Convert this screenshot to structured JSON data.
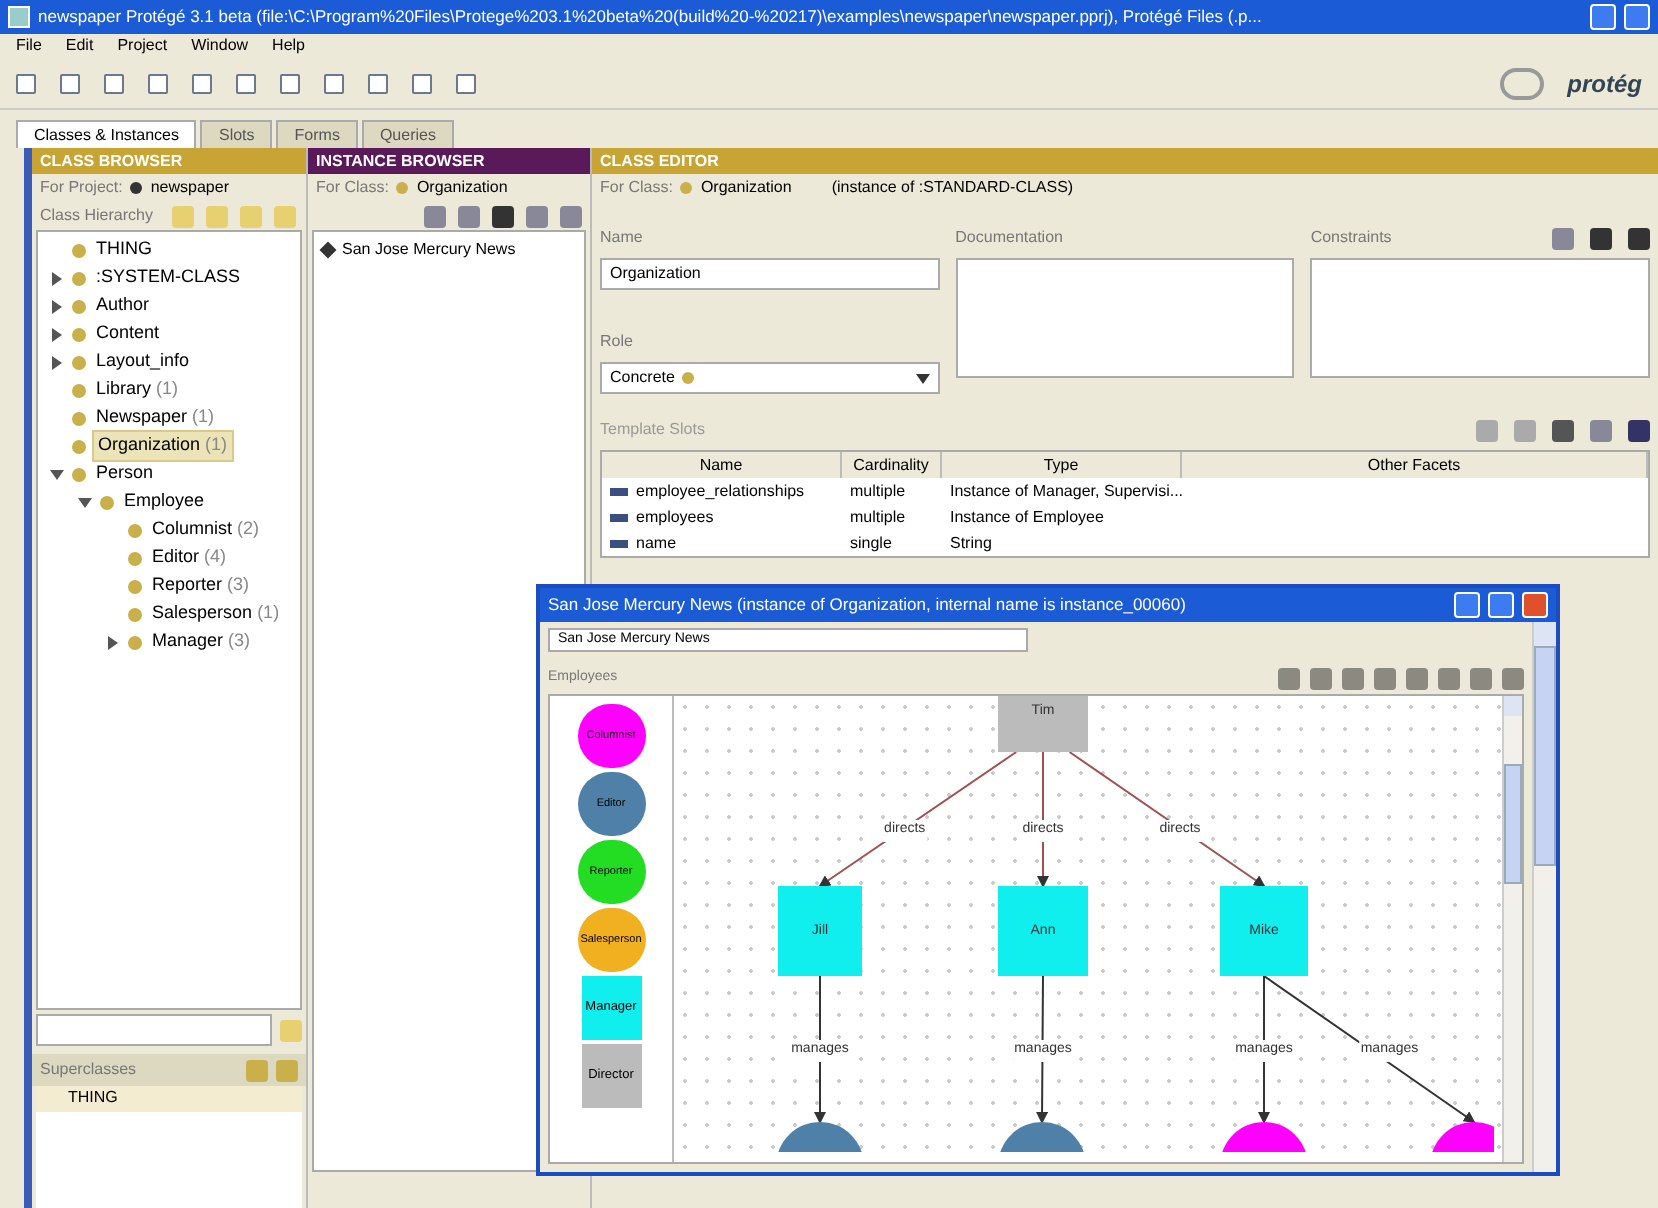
{
  "window": {
    "title": "newspaper  Protégé 3.1 beta   (file:\\C:\\Program%20Files\\Protege%203.1%20beta%20(build%20-%20217)\\examples\\newspaper\\newspaper.pprj), Protégé Files (.p..."
  },
  "menu": [
    "File",
    "Edit",
    "Project",
    "Window",
    "Help"
  ],
  "logo": "protég",
  "tabs": [
    {
      "label": "Classes & Instances",
      "selected": true
    },
    {
      "label": "Slots",
      "selected": false
    },
    {
      "label": "Forms",
      "selected": false
    },
    {
      "label": "Queries",
      "selected": false
    }
  ],
  "class_browser": {
    "header": "CLASS BROWSER",
    "project_label": "For Project:",
    "project": "newspaper",
    "hierarchy_label": "Class Hierarchy",
    "tree": [
      {
        "label": "THING",
        "selected": false
      },
      {
        "label": ":SYSTEM-CLASS",
        "expanded": false,
        "selected": false
      },
      {
        "label": "Author",
        "expanded": false,
        "selected": false
      },
      {
        "label": "Content",
        "expanded": false,
        "selected": false
      },
      {
        "label": "Layout_info",
        "expanded": false,
        "selected": false
      },
      {
        "label": "Library",
        "count": "(1)",
        "selected": false
      },
      {
        "label": "Newspaper",
        "count": "(1)",
        "selected": false
      },
      {
        "label": "Organization",
        "count": "(1)",
        "selected": true
      },
      {
        "label": "Person",
        "expanded": true,
        "selected": false,
        "children": [
          {
            "label": "Employee",
            "expanded": true,
            "selected": false,
            "children": [
              {
                "label": "Columnist",
                "count": "(2)",
                "selected": false
              },
              {
                "label": "Editor",
                "count": "(4)",
                "selected": false
              },
              {
                "label": "Reporter",
                "count": "(3)",
                "selected": false
              },
              {
                "label": "Salesperson",
                "count": "(1)",
                "selected": false
              },
              {
                "label": "Manager",
                "count": "(3)",
                "expanded": false,
                "selected": false
              }
            ]
          }
        ]
      }
    ],
    "superclasses_label": "Superclasses",
    "superclasses": [
      "THING"
    ]
  },
  "instance_browser": {
    "header": "INSTANCE BROWSER",
    "class_label": "For Class:",
    "class": "Organization",
    "instances": [
      {
        "label": "San Jose Mercury News",
        "selected": false
      }
    ]
  },
  "class_editor": {
    "header": "CLASS EDITOR",
    "class_label": "For Class:",
    "class": "Organization",
    "instance_of": "(instance of :STANDARD-CLASS)",
    "name_label": "Name",
    "name": "Organization",
    "documentation_label": "Documentation",
    "constraints_label": "Constraints",
    "role_label": "Role",
    "role": "Concrete",
    "template_slots_label": "Template Slots",
    "columns": [
      "Name",
      "Cardinality",
      "Type",
      "Other Facets"
    ],
    "rows": [
      [
        "employee_relationships",
        "multiple",
        "Instance of Manager, Supervisi...",
        ""
      ],
      [
        "employees",
        "multiple",
        "Instance of Employee",
        ""
      ],
      [
        "name",
        "single",
        "String",
        ""
      ]
    ]
  },
  "instance_window": {
    "title": "San Jose Mercury News   (instance of Organization, internal name is instance_00060)",
    "name_value": "San Jose Mercury News",
    "employees_label": "Employees",
    "legend": [
      {
        "label": "Columnist",
        "kind": "circle",
        "color": "#ff00ff"
      },
      {
        "label": "Editor",
        "kind": "circle",
        "color": "#4f81a8"
      },
      {
        "label": "Reporter",
        "kind": "circle",
        "color": "#22dd22"
      },
      {
        "label": "Salesperson",
        "kind": "circle",
        "color": "#f0b020"
      },
      {
        "label": "Manager",
        "kind": "square",
        "color": "#11eeee"
      },
      {
        "label": "Director",
        "kind": "square",
        "color": "#bbbbbb"
      }
    ],
    "nodes": [
      {
        "label": "Tim",
        "kind": "square",
        "color": "#bbbbbb"
      },
      {
        "label": "Jill",
        "kind": "square",
        "color": "#11eeee"
      },
      {
        "label": "Ann",
        "kind": "square",
        "color": "#11eeee"
      },
      {
        "label": "Mike",
        "kind": "square",
        "color": "#11eeee"
      },
      {
        "kind": "circle",
        "color": "#4f81a8"
      },
      {
        "kind": "circle",
        "color": "#4f81a8"
      },
      {
        "kind": "circle",
        "color": "#ff00ff"
      },
      {
        "kind": "circle",
        "color": "#ff00ff"
      }
    ],
    "edges": [
      {
        "label": "directs"
      },
      {
        "label": "directs"
      },
      {
        "label": "directs"
      },
      {
        "label": "manages"
      },
      {
        "label": "manages"
      },
      {
        "label": "manages"
      },
      {
        "label": "manages"
      }
    ]
  }
}
